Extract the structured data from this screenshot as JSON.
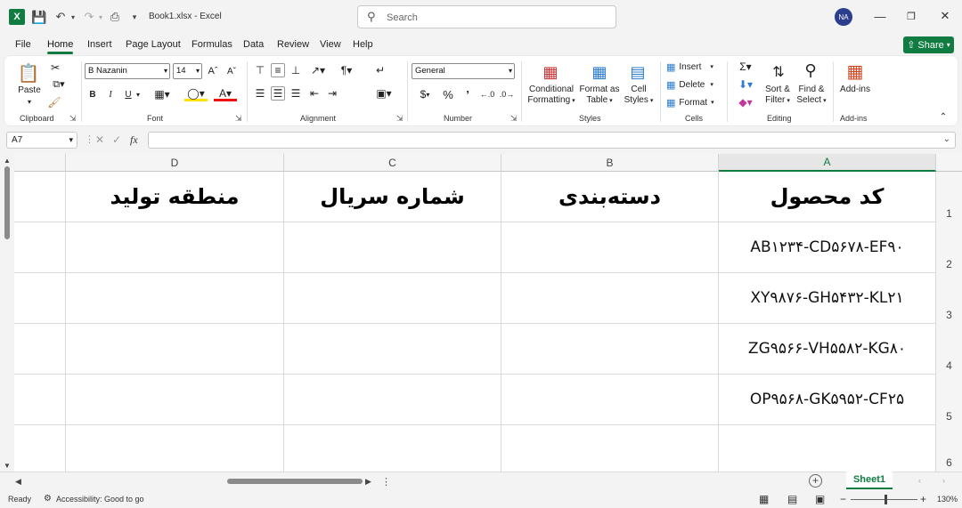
{
  "titlebar": {
    "doc_title": "Book1.xlsx  -  Excel",
    "search_placeholder": "Search",
    "avatar_initials": "NA"
  },
  "menu": {
    "tabs": [
      "File",
      "Home",
      "Insert",
      "Page Layout",
      "Formulas",
      "Data",
      "Review",
      "View",
      "Help"
    ],
    "active": "Home",
    "share_label": "Share"
  },
  "ribbon": {
    "clipboard": {
      "paste": "Paste",
      "label": "Clipboard"
    },
    "font": {
      "name": "B Nazanin",
      "size": "14",
      "label": "Font",
      "bold": "B",
      "italic": "I",
      "underline": "U"
    },
    "alignment": {
      "label": "Alignment"
    },
    "number": {
      "format": "General",
      "label": "Number",
      "currency": "$",
      "percent": "%"
    },
    "styles": {
      "label": "Styles",
      "conditional_line1": "Conditional",
      "conditional_line2": "Formatting",
      "format_table_line1": "Format as",
      "format_table_line2": "Table",
      "cell_styles_line1": "Cell",
      "cell_styles_line2": "Styles"
    },
    "cells": {
      "label": "Cells",
      "insert": "Insert",
      "delete": "Delete",
      "format": "Format"
    },
    "editing": {
      "label": "Editing",
      "sort_line1": "Sort &",
      "sort_line2": "Filter",
      "find_line1": "Find &",
      "find_line2": "Select"
    },
    "addins": {
      "label": "Add-ins",
      "button": "Add-ins"
    }
  },
  "formula_bar": {
    "name_box": "A7",
    "fx": "fx",
    "value": ""
  },
  "sheet": {
    "columns": [
      "A",
      "B",
      "C",
      "D"
    ],
    "selected_column": "A",
    "rows": [
      "1",
      "2",
      "3",
      "4",
      "5",
      "6"
    ],
    "header_row": {
      "A": "کد محصول",
      "B": "دسته‌بندی",
      "C": "شماره سریال",
      "D": "منطقه تولید"
    },
    "data_rows": [
      {
        "A": "AB۱۲۳۴-CD۵۶۷۸-EF۹۰"
      },
      {
        "A": "XY۹۸۷۶-GH۵۴۳۲-KL۲۱"
      },
      {
        "A": "ZG۹۵۶۶-VH۵۵۸۲-KG۸۰"
      },
      {
        "A": "OP۹۵۶۸-GK۵۹۵۲-CF۲۵"
      }
    ]
  },
  "sheet_tabs": {
    "active": "Sheet1"
  },
  "status": {
    "ready": "Ready",
    "accessibility": "Accessibility: Good to go",
    "zoom": "130%"
  }
}
